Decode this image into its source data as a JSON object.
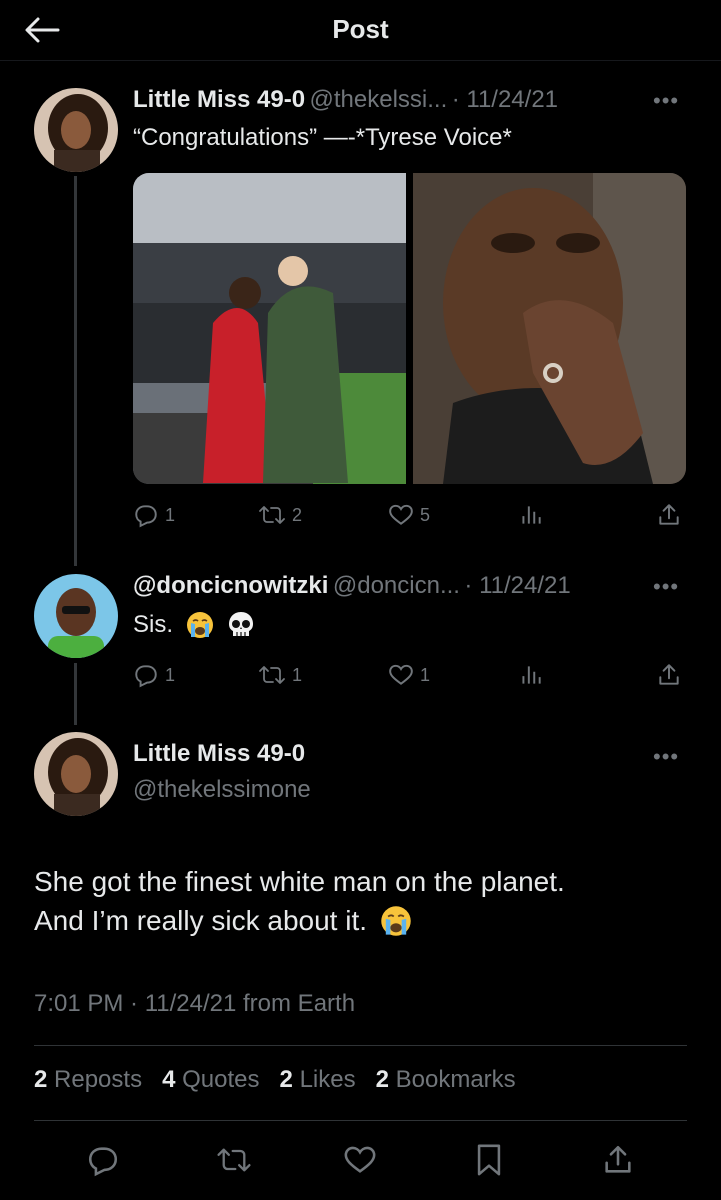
{
  "header": {
    "title": "Post"
  },
  "tweets": [
    {
      "name": "Little Miss 49-0",
      "handle": "@thekelssi...",
      "date": "· 11/24/21",
      "text": "“Congratulations” —-*Tyrese Voice*",
      "replies": "1",
      "reposts": "2",
      "likes": "5"
    },
    {
      "name": "@doncicnowitzki",
      "handle": "@doncicn...",
      "date": "· 11/24/21",
      "text": "Sis.",
      "replies": "1",
      "reposts": "1",
      "likes": "1"
    }
  ],
  "main_post": {
    "name": "Little Miss 49-0",
    "handle": "@thekelssimone",
    "line1": "She got the finest white man on the planet.",
    "line2": "And I’m really sick about it.",
    "timestamp": "7:01 PM · 11/24/21 from Earth",
    "stats": {
      "reposts_count": "2",
      "reposts_label": "Reposts",
      "quotes_count": "4",
      "quotes_label": "Quotes",
      "likes_count": "2",
      "likes_label": "Likes",
      "bookmarks_count": "2",
      "bookmarks_label": "Bookmarks"
    }
  },
  "icons": {
    "back": "arrow-left-icon",
    "reply": "reply-icon",
    "repost": "repost-icon",
    "like": "heart-icon",
    "views": "views-icon",
    "share": "share-icon",
    "bookmark": "bookmark-icon",
    "more": "more-icon"
  },
  "colors": {
    "background": "#000000",
    "text": "#e7e9ea",
    "muted": "#71767b",
    "divider": "#2f3336"
  }
}
